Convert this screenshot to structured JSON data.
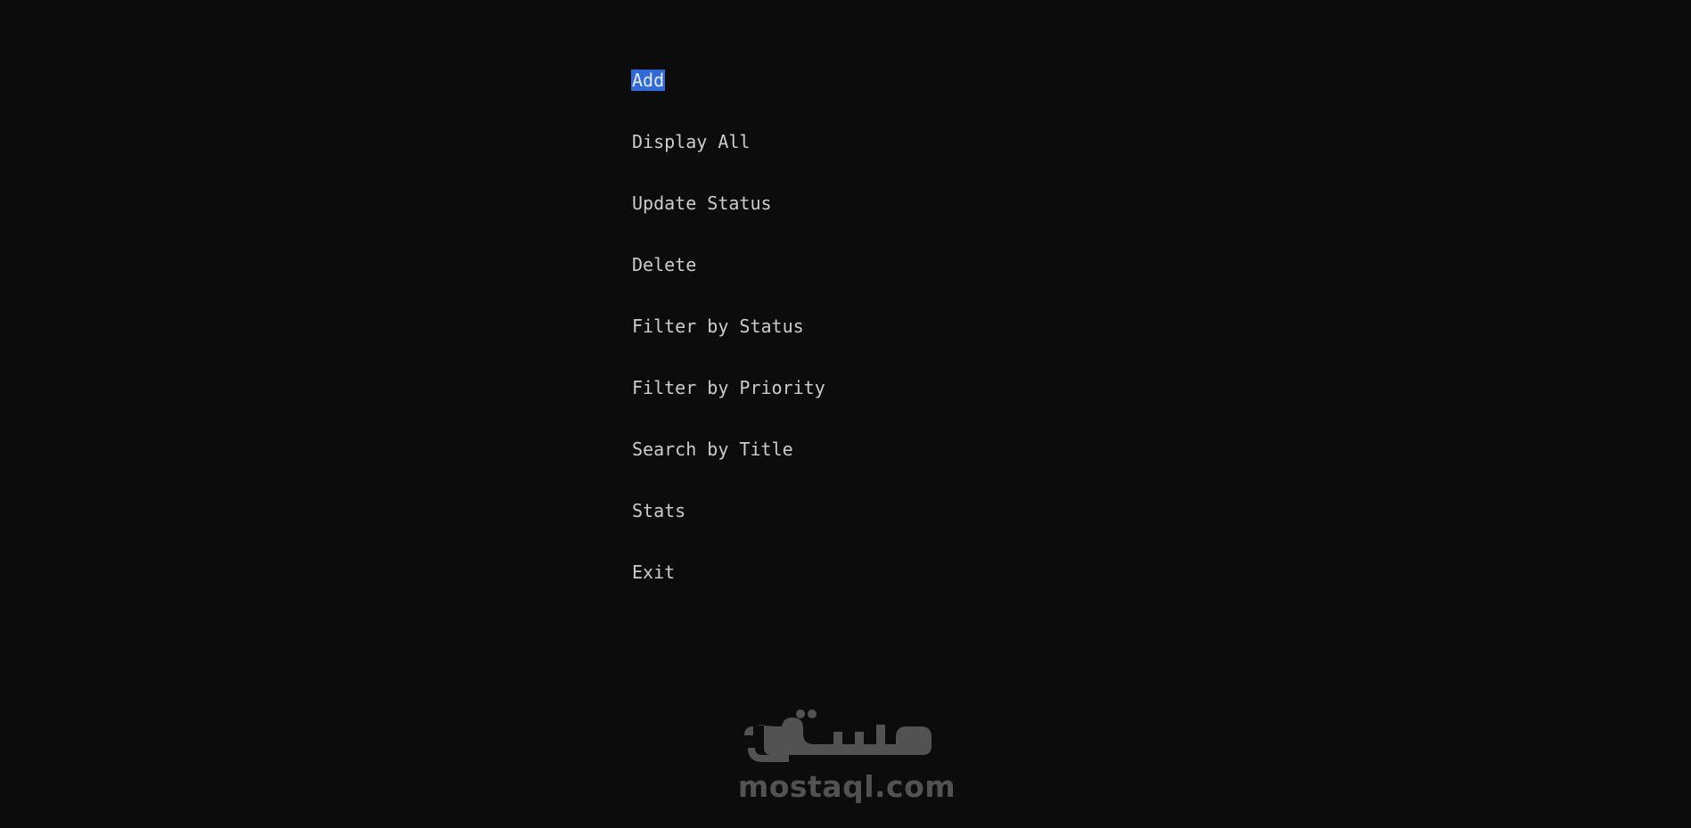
{
  "menu": {
    "selected_index": 0,
    "items": [
      {
        "label": "Add"
      },
      {
        "label": "Display All"
      },
      {
        "label": "Update Status"
      },
      {
        "label": "Delete"
      },
      {
        "label": "Filter by Status"
      },
      {
        "label": "Filter by Priority"
      },
      {
        "label": "Search by Title"
      },
      {
        "label": "Stats"
      },
      {
        "label": "Exit"
      }
    ]
  },
  "watermark": {
    "arabic": "مستقل",
    "domain": "mostaql.com"
  },
  "colors": {
    "background": "#0c0c0c",
    "text": "#cccccc",
    "selection": "#2e6bd8"
  }
}
